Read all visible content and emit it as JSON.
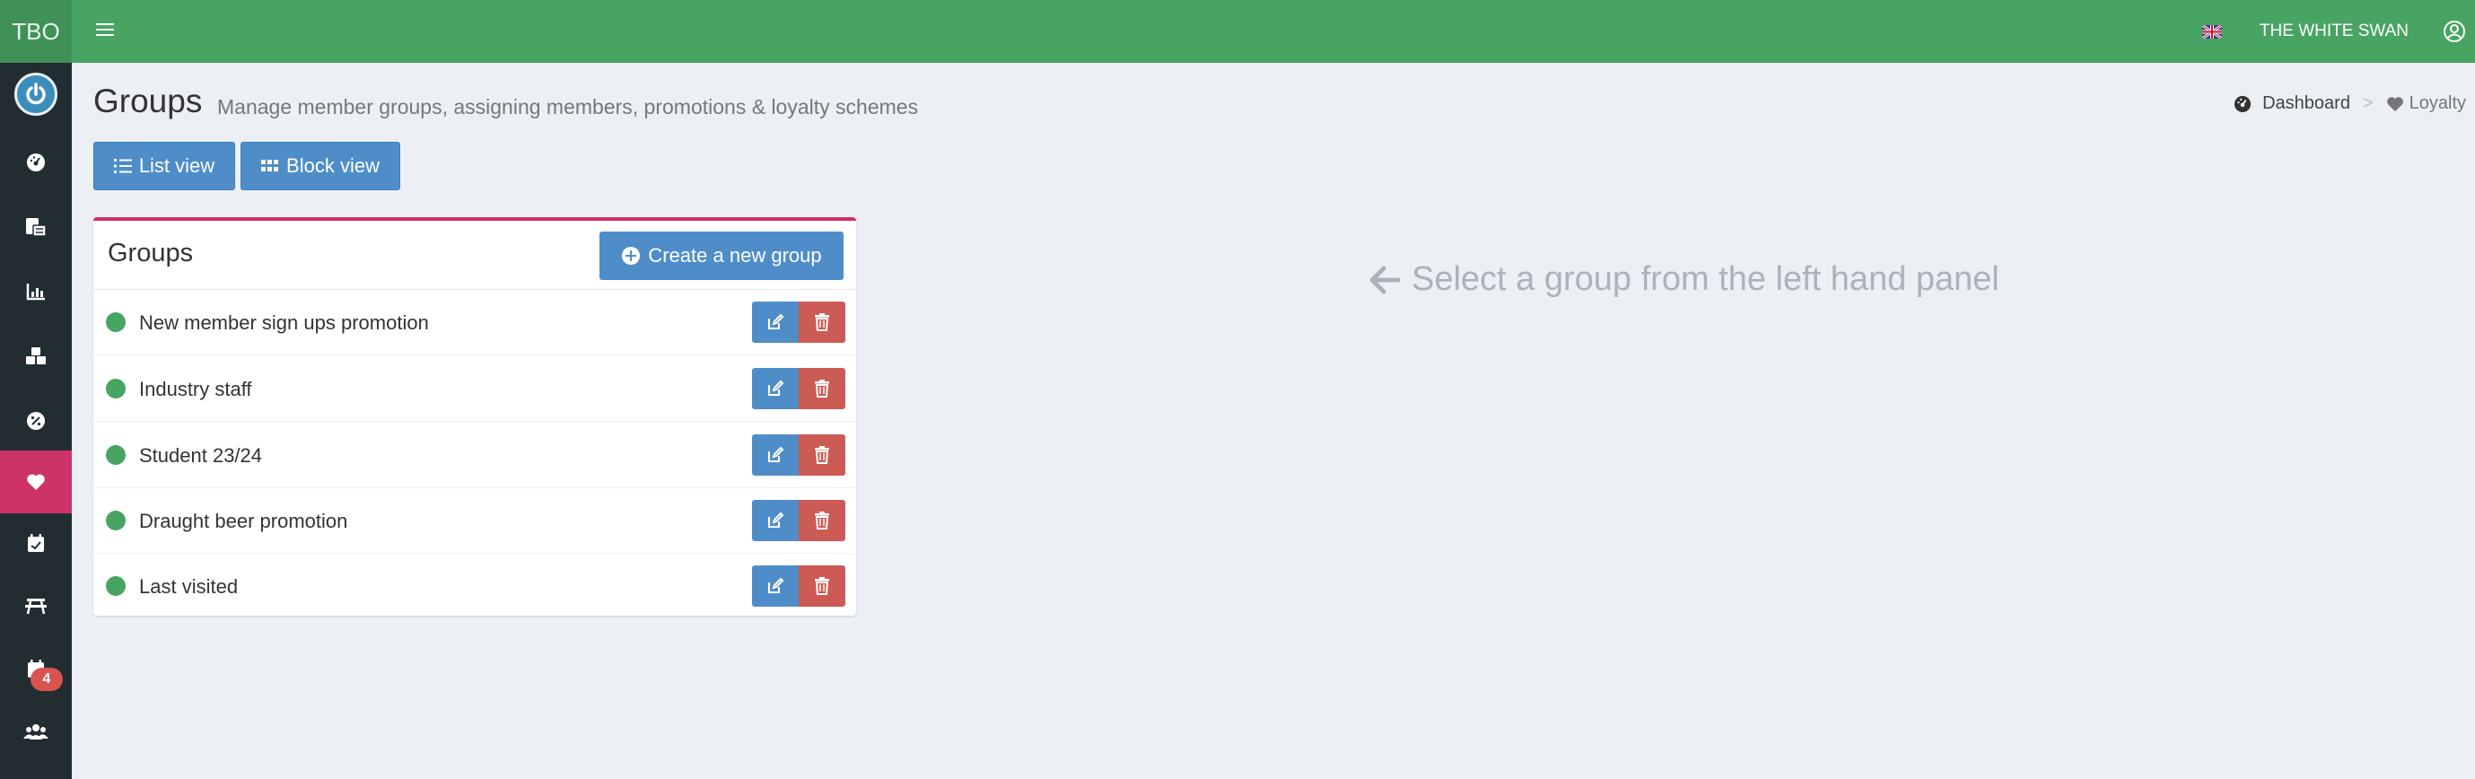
{
  "topbar": {
    "logo": "TBO",
    "venue": "THE WHITE SWAN",
    "icons": [
      "menu-icon",
      "uk-flag-icon",
      "user-icon"
    ],
    "color": "#48a462"
  },
  "sidebar": {
    "items": [
      {
        "icon": "power-icon"
      },
      {
        "icon": "dashboard-icon"
      },
      {
        "icon": "orders-icon"
      },
      {
        "icon": "reports-icon"
      },
      {
        "icon": "products-icon"
      },
      {
        "icon": "discounts-icon"
      },
      {
        "icon": "heart-icon",
        "active": true
      },
      {
        "icon": "calendar-check-icon"
      },
      {
        "icon": "tables-icon"
      },
      {
        "icon": "bookings-icon",
        "badge": "4"
      },
      {
        "icon": "members-icon"
      }
    ],
    "active_color": "#cc3366"
  },
  "header": {
    "title": "Groups",
    "subtitle": "Manage member groups, assigning members, promotions & loyalty schemes"
  },
  "breadcrumb": {
    "dashboard": "Dashboard",
    "separator": ">",
    "current": "Loyalty"
  },
  "views": {
    "list": "List view",
    "block": "Block view"
  },
  "panel": {
    "title": "Groups",
    "create_label": "Create a new group",
    "rows": [
      {
        "label": "New member sign ups promotion",
        "status": "active"
      },
      {
        "label": "Industry staff",
        "status": "active"
      },
      {
        "label": "Student 23/24",
        "status": "active"
      },
      {
        "label": "Draught beer promotion",
        "status": "active"
      },
      {
        "label": "Last visited",
        "status": "active"
      }
    ]
  },
  "placeholder": "Select a group from the left hand panel"
}
